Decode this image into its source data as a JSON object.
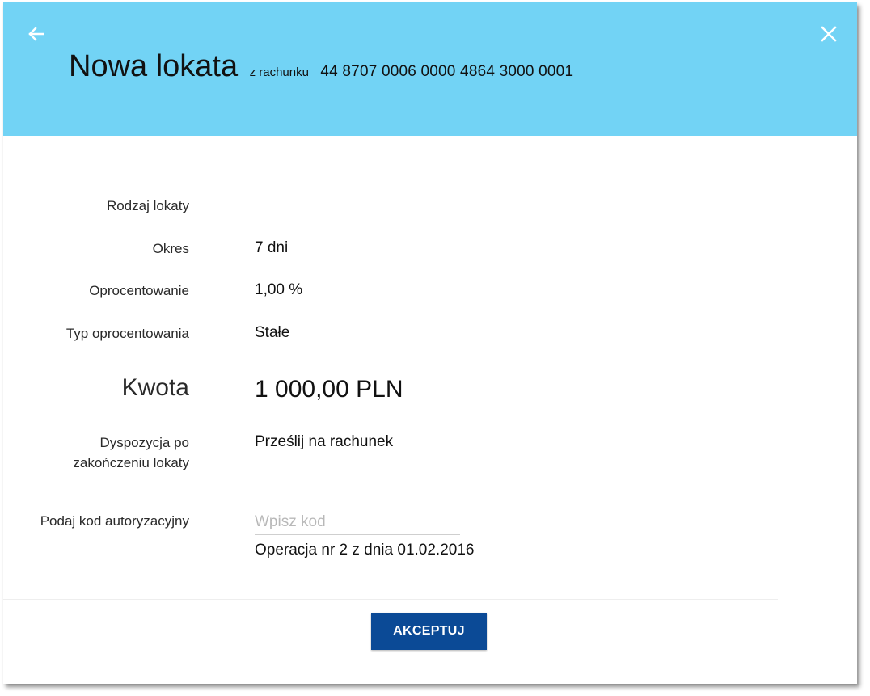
{
  "header": {
    "title": "Nowa lokata",
    "from_label": "z rachunku",
    "account_number": "44 8707 0006 0000 4864 3000 0001",
    "back_icon": "arrow-left-icon",
    "close_icon": "close-icon",
    "background_color": "#72d3f5"
  },
  "details": {
    "deposit_type": {
      "label": "Rodzaj lokaty",
      "value": ""
    },
    "period": {
      "label": "Okres",
      "value": "7 dni"
    },
    "interest_rate": {
      "label": "Oprocentowanie",
      "value": "1,00 %"
    },
    "interest_type": {
      "label": "Typ oprocentowania",
      "value": "Stałe"
    },
    "amount": {
      "label": "Kwota",
      "value": "1 000,00",
      "currency": "PLN"
    },
    "disposition": {
      "label_line1": "Dyspozycja po",
      "label_line2": "zakończeniu lokaty",
      "value": "Prześlij na rachunek"
    }
  },
  "authorization": {
    "label": "Podaj kod autoryzacyjny",
    "placeholder": "Wpisz kod",
    "value": "",
    "operation_info": "Operacja nr 2 z dnia 01.02.2016"
  },
  "actions": {
    "accept_label": "AKCEPTUJ",
    "accept_color": "#0b4a96"
  }
}
